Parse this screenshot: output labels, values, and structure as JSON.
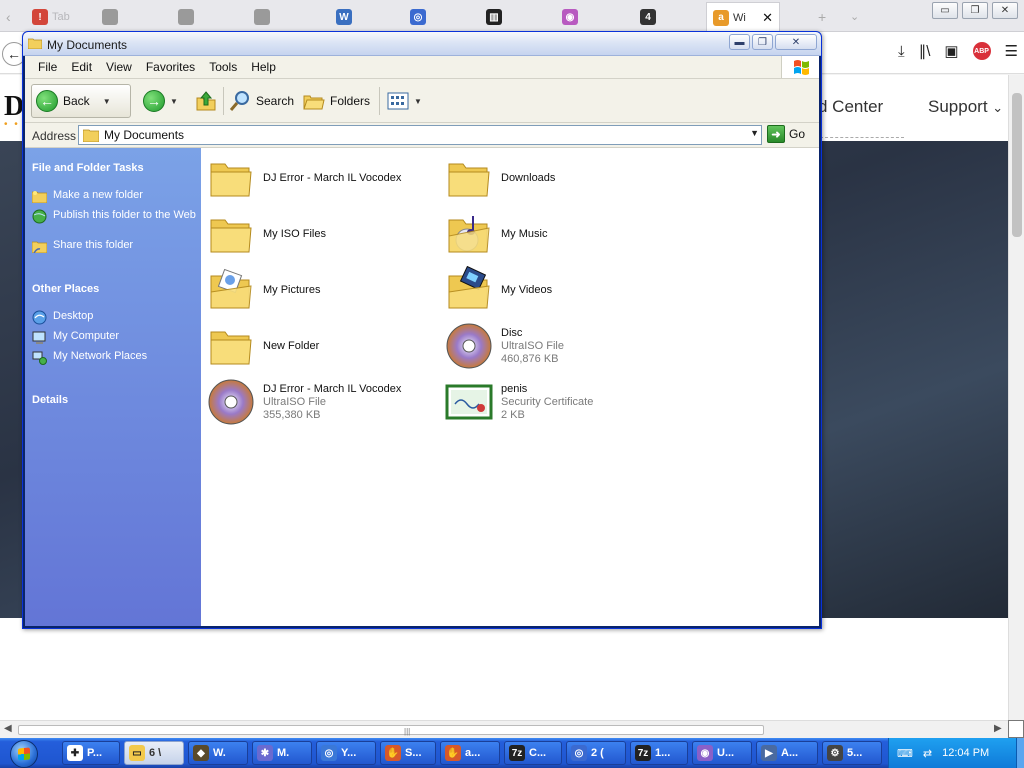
{
  "browser": {
    "tabs": [
      {
        "label": "Tab",
        "color": "#d3463a",
        "glyph": "!"
      },
      {
        "label": "",
        "color": "#9a9a9a",
        "glyph": ""
      },
      {
        "label": "",
        "color": "#9a9a9a",
        "glyph": ""
      },
      {
        "label": "",
        "color": "#9a9a9a",
        "glyph": ""
      },
      {
        "label": "",
        "color": "#3a6fc0",
        "glyph": "W"
      },
      {
        "label": "",
        "color": "#3b6ad0",
        "glyph": "◎"
      },
      {
        "label": "",
        "color": "#222222",
        "glyph": "▥"
      },
      {
        "label": "",
        "color": "#b85ac0",
        "glyph": "◉"
      },
      {
        "label": "",
        "color": "#333333",
        "glyph": "4"
      },
      {
        "label": "Wi",
        "color": "#e89a2a",
        "glyph": "a",
        "active": true
      }
    ],
    "tab_close": "✕",
    "new_tab": "+",
    "tab_list": "⌄",
    "window_controls": {
      "minimize": "▭",
      "maximize": "❐",
      "close": "✕"
    },
    "nav_back": "←",
    "toolbar_icons": {
      "download": "⤓",
      "library": "∥\\",
      "reader": "▣",
      "adblock": "ABP",
      "menu": "☰"
    }
  },
  "website": {
    "logo": "D",
    "nav_items": [
      "d Center",
      "Support"
    ],
    "support_caret": "⌄",
    "hero_color": "#2f3a4a"
  },
  "explorer": {
    "title": "My Documents",
    "controls": {
      "minimize": "▬",
      "maximize": "❐",
      "close": "✕"
    },
    "menu": [
      "File",
      "Edit",
      "View",
      "Favorites",
      "Tools",
      "Help"
    ],
    "toolbar": {
      "back": "Back",
      "search": "Search",
      "folders": "Folders"
    },
    "address": {
      "label": "Address",
      "value": "My Documents",
      "go": "Go"
    },
    "tasks": {
      "file_folder_title": "File and Folder Tasks",
      "file_folder_items": [
        "Make a new folder",
        "Publish this folder to the Web",
        "Share this folder"
      ],
      "other_places_title": "Other Places",
      "other_places_items": [
        "Desktop",
        "My Computer",
        "My Network Places"
      ],
      "details_title": "Details"
    },
    "files": [
      {
        "name": "DJ Error - March IL Vocodex",
        "type": "folder",
        "sub1": "",
        "sub2": ""
      },
      {
        "name": "Downloads",
        "type": "folder",
        "sub1": "",
        "sub2": ""
      },
      {
        "name": "My ISO Files",
        "type": "folder",
        "sub1": "",
        "sub2": ""
      },
      {
        "name": "My Music",
        "type": "music-folder",
        "sub1": "",
        "sub2": ""
      },
      {
        "name": "My Pictures",
        "type": "pictures-folder",
        "sub1": "",
        "sub2": ""
      },
      {
        "name": "My Videos",
        "type": "videos-folder",
        "sub1": "",
        "sub2": ""
      },
      {
        "name": "New Folder",
        "type": "folder",
        "sub1": "",
        "sub2": ""
      },
      {
        "name": "Disc",
        "type": "disc",
        "sub1": "UltraISO File",
        "sub2": "460,876 KB"
      },
      {
        "name": "DJ Error - March IL Vocodex",
        "type": "disc",
        "sub1": "UltraISO File",
        "sub2": "355,380 KB"
      },
      {
        "name": "penis",
        "type": "certificate",
        "sub1": "Security Certificate",
        "sub2": "2 KB"
      }
    ]
  },
  "taskbar": {
    "tasks": [
      {
        "label": "P...",
        "color": "#ffffff",
        "glyph": "✚"
      },
      {
        "label": "6 \\",
        "color": "#f2c94c",
        "glyph": "▭",
        "active": true
      },
      {
        "label": "W.",
        "color": "#5a4a2a",
        "glyph": "◆"
      },
      {
        "label": "M.",
        "color": "#6a6ad0",
        "glyph": "✱"
      },
      {
        "label": "Y...",
        "color": "#3a78d8",
        "glyph": "◎"
      },
      {
        "label": "S...",
        "color": "#d8582a",
        "glyph": "✋"
      },
      {
        "label": "a...",
        "color": "#d8582a",
        "glyph": "✋"
      },
      {
        "label": "C...",
        "color": "#222222",
        "glyph": "7z"
      },
      {
        "label": "2 (",
        "color": "#3b6ad0",
        "glyph": "◎"
      },
      {
        "label": "1...",
        "color": "#222222",
        "glyph": "7z"
      },
      {
        "label": "U...",
        "color": "#8a60c8",
        "glyph": "◉"
      },
      {
        "label": "A...",
        "color": "#4a6aa0",
        "glyph": "▶"
      },
      {
        "label": "5...",
        "color": "#444444",
        "glyph": "⚙"
      }
    ],
    "clock": "12:04 PM",
    "tray_keyboard": "⌨",
    "tray_network": "⇄"
  }
}
